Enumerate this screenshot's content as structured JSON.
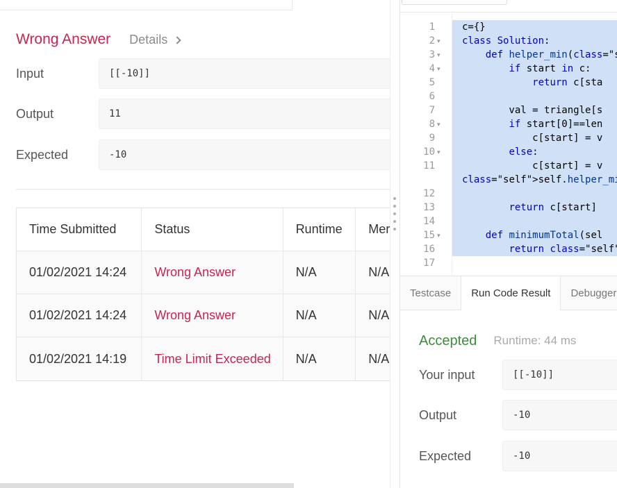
{
  "submission": {
    "result_title": "Wrong Answer",
    "details_label": "Details",
    "input_label": "Input",
    "input_value": "[[-10]]",
    "output_label": "Output",
    "output_value": "11",
    "expected_label": "Expected",
    "expected_value": "-10"
  },
  "history": {
    "headers": [
      "Time Submitted",
      "Status",
      "Runtime",
      "Mer"
    ],
    "rows": [
      {
        "time": "01/02/2021 14:24",
        "status": "Wrong Answer",
        "runtime": "N/A",
        "memory": "N/A"
      },
      {
        "time": "01/02/2021 14:24",
        "status": "Wrong Answer",
        "runtime": "N/A",
        "memory": "N/A"
      },
      {
        "time": "01/02/2021 14:19",
        "status": "Time Limit Exceeded",
        "runtime": "N/A",
        "memory": "N/A"
      }
    ]
  },
  "editor": {
    "line_numbers": [
      "1",
      "2",
      "3",
      "4",
      "5",
      "6",
      "7",
      "8",
      "9",
      "10",
      "11",
      "",
      "12",
      "13",
      "14",
      "15",
      "16",
      "17"
    ],
    "lines": [
      "c={}",
      "class Solution:",
      "    def helper_min(self,",
      "        if start in c:",
      "            return c[sta",
      "",
      "        val = triangle[s",
      "        if start[0]==len",
      "            c[start] = v",
      "        else:",
      "            c[start] = v",
      "self.helper_min(triangle",
      "",
      "        return c[start]",
      "",
      "    def minimumTotal(sel",
      "        return self.help",
      ""
    ]
  },
  "tabs": [
    "Testcase",
    "Run Code Result",
    "Debugger"
  ],
  "run_result": {
    "status": "Accepted",
    "runtime": "Runtime: 44 ms",
    "input_label": "Your input",
    "input_value": "[[-10]]",
    "output_label": "Output",
    "output_value": "-10",
    "expected_label": "Expected",
    "expected_value": "-10"
  },
  "colors": {
    "wrong": "#c7254e",
    "accepted": "#3d8b3d",
    "selection": "#cfe0f7"
  }
}
